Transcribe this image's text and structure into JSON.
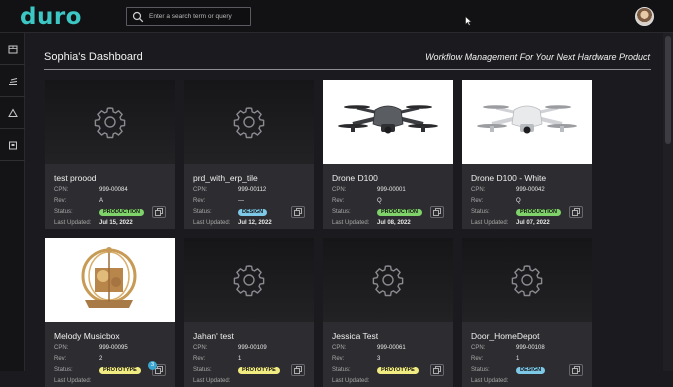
{
  "app": {
    "logo": "duro"
  },
  "search": {
    "placeholder": "Enter a search term or query"
  },
  "header": {
    "title": "Sophia's Dashboard",
    "tagline": "Workflow Management For Your Next Hardware Product"
  },
  "labels": {
    "cpn": "CPN:",
    "rev": "Rev:",
    "status": "Status:",
    "updated": "Last Updated:"
  },
  "cards": [
    {
      "name": "test proood",
      "cpn": "999-00084",
      "rev": "A",
      "status": "PRODUCTION",
      "status_kind": "production",
      "updated": "Jul 15, 2022",
      "image": "gear"
    },
    {
      "name": "prd_with_erp_tile",
      "cpn": "999-00112",
      "rev": "—",
      "status": "DESIGN",
      "status_kind": "design",
      "updated": "Jul 12, 2022",
      "image": "gear"
    },
    {
      "name": "Drone D100",
      "cpn": "999-00001",
      "rev": "Q",
      "status": "PRODUCTION",
      "status_kind": "production",
      "updated": "Jul 08, 2022",
      "image": "drone-dark"
    },
    {
      "name": "Drone D100 - White",
      "cpn": "999-00042",
      "rev": "Q",
      "status": "PRODUCTION",
      "status_kind": "production",
      "updated": "Jul 07, 2022",
      "image": "drone-white"
    },
    {
      "name": "Melody Musicbox",
      "cpn": "999-00095",
      "rev": "2",
      "status": "PROTOTYPE",
      "status_kind": "prototype",
      "updated": "",
      "image": "musicbox",
      "bubble": "3"
    },
    {
      "name": "Jahan' test",
      "cpn": "999-00109",
      "rev": "1",
      "status": "PROTOTYPE",
      "status_kind": "prototype",
      "updated": "",
      "image": "gear"
    },
    {
      "name": "Jessica Test",
      "cpn": "999-00061",
      "rev": "3",
      "status": "PROTOTYPE",
      "status_kind": "prototype",
      "updated": "",
      "image": "gear"
    },
    {
      "name": "Door_HomeDepot",
      "cpn": "999-00108",
      "rev": "1",
      "status": "DESIGN",
      "status_kind": "design",
      "updated": "",
      "image": "gear"
    }
  ],
  "colors": {
    "brand": "#3cc7c4",
    "production": "#7fd36a",
    "design": "#7fc9e8",
    "prototype": "#f1ec82"
  }
}
